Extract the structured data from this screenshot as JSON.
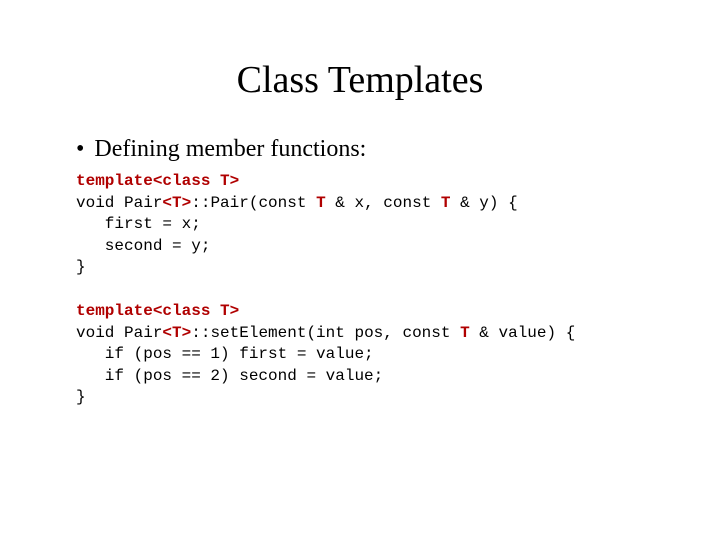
{
  "title": "Class Templates",
  "bullet": "Defining member functions:",
  "code1": {
    "l1a": "template<class T>",
    "l2a": "void Pair",
    "l2b": "<T>",
    "l2c": "::Pair(const ",
    "l2d": "T",
    "l2e": " & x, const ",
    "l2f": "T",
    "l2g": " & y) {",
    "l3": "   first = x;",
    "l4": "   second = y;",
    "l5": "}"
  },
  "code2": {
    "l1a": "template<class T>",
    "l2a": "void Pair",
    "l2b": "<T>",
    "l2c": "::setElement(int pos, const ",
    "l2d": "T",
    "l2e": " & value) {",
    "l3": "   if (pos == 1) first = value;",
    "l4": "   if (pos == 2) second = value;",
    "l5": "}"
  }
}
